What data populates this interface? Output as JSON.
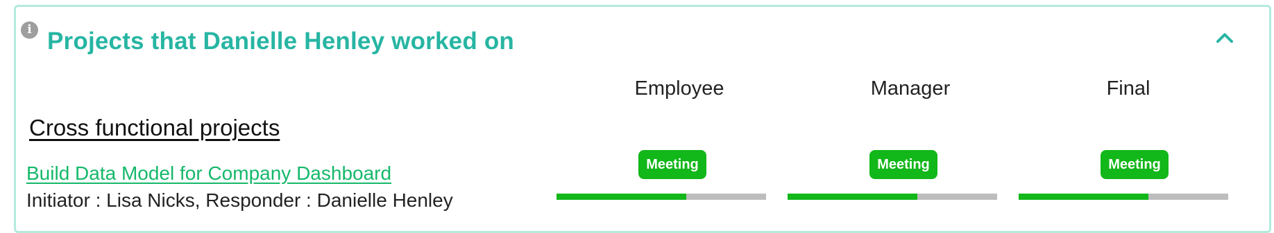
{
  "panel": {
    "title": "Projects that Danielle Henley worked on"
  },
  "columns": [
    {
      "header": "Employee",
      "badge": "Meeting",
      "progress": 0.62
    },
    {
      "header": "Manager",
      "badge": "Meeting",
      "progress": 0.62
    },
    {
      "header": "Final",
      "badge": "Meeting",
      "progress": 0.62
    }
  ],
  "section": {
    "heading": "Cross functional projects",
    "project": {
      "name": "Build Data Model for Company Dashboard",
      "meta": "Initiator : Lisa Nicks, Responder : Danielle Henley",
      "meta_cut": ""
    }
  },
  "colors": {
    "accent_teal": "#27b5a3",
    "border": "#b2ebdd",
    "badge_green": "#12b719",
    "link_green": "#15b86a",
    "bar_track": "#bdbdbd"
  },
  "icons": {
    "info": "info-icon",
    "collapse": "chevron-up-icon"
  }
}
